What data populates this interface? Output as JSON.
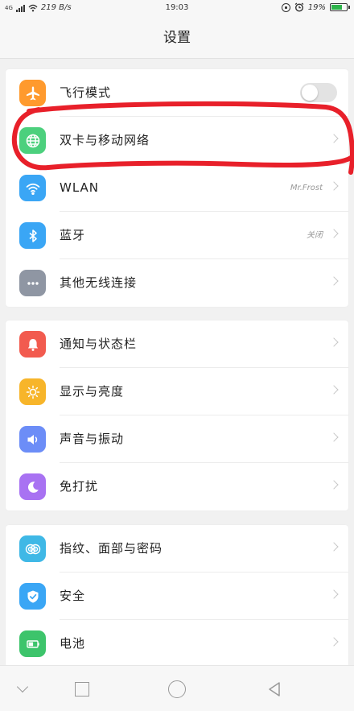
{
  "status_bar": {
    "signal_label": "4G",
    "speed": "219 B/s",
    "time": "19:03",
    "battery_percent": "19%"
  },
  "page": {
    "title": "设置"
  },
  "groups": [
    {
      "items": [
        {
          "label": "飞行模式",
          "icon": "airplane-icon",
          "color": "#ff9a2e",
          "control": "toggle",
          "toggle_on": false
        },
        {
          "label": "双卡与移动网络",
          "icon": "globe-icon",
          "color": "#4cd07d",
          "control": "chevron"
        },
        {
          "label": "WLAN",
          "value": "Mr.Frost",
          "icon": "wifi-icon",
          "color": "#3aa6f5",
          "control": "chevron"
        },
        {
          "label": "蓝牙",
          "value": "关闭",
          "icon": "bluetooth-icon",
          "color": "#3aa6f5",
          "control": "chevron"
        },
        {
          "label": "其他无线连接",
          "icon": "more-icon",
          "color": "#8f96a3",
          "control": "chevron"
        }
      ]
    },
    {
      "items": [
        {
          "label": "通知与状态栏",
          "icon": "bell-icon",
          "color": "#f25b4f",
          "control": "chevron"
        },
        {
          "label": "显示与亮度",
          "icon": "sun-icon",
          "color": "#f7b52a",
          "control": "chevron"
        },
        {
          "label": "声音与振动",
          "icon": "speaker-icon",
          "color": "#6c8df7",
          "control": "chevron"
        },
        {
          "label": "免打扰",
          "icon": "moon-icon",
          "color": "#a872f2",
          "control": "chevron"
        }
      ]
    },
    {
      "items": [
        {
          "label": "指纹、面部与密码",
          "icon": "fingerprint-icon",
          "color": "#3fb8e6",
          "control": "chevron"
        },
        {
          "label": "安全",
          "icon": "shield-icon",
          "color": "#3aa6f5",
          "control": "chevron"
        },
        {
          "label": "电池",
          "icon": "battery-icon",
          "color": "#3dc46b",
          "control": "chevron"
        }
      ]
    }
  ],
  "annotation_color": "#e8202a"
}
